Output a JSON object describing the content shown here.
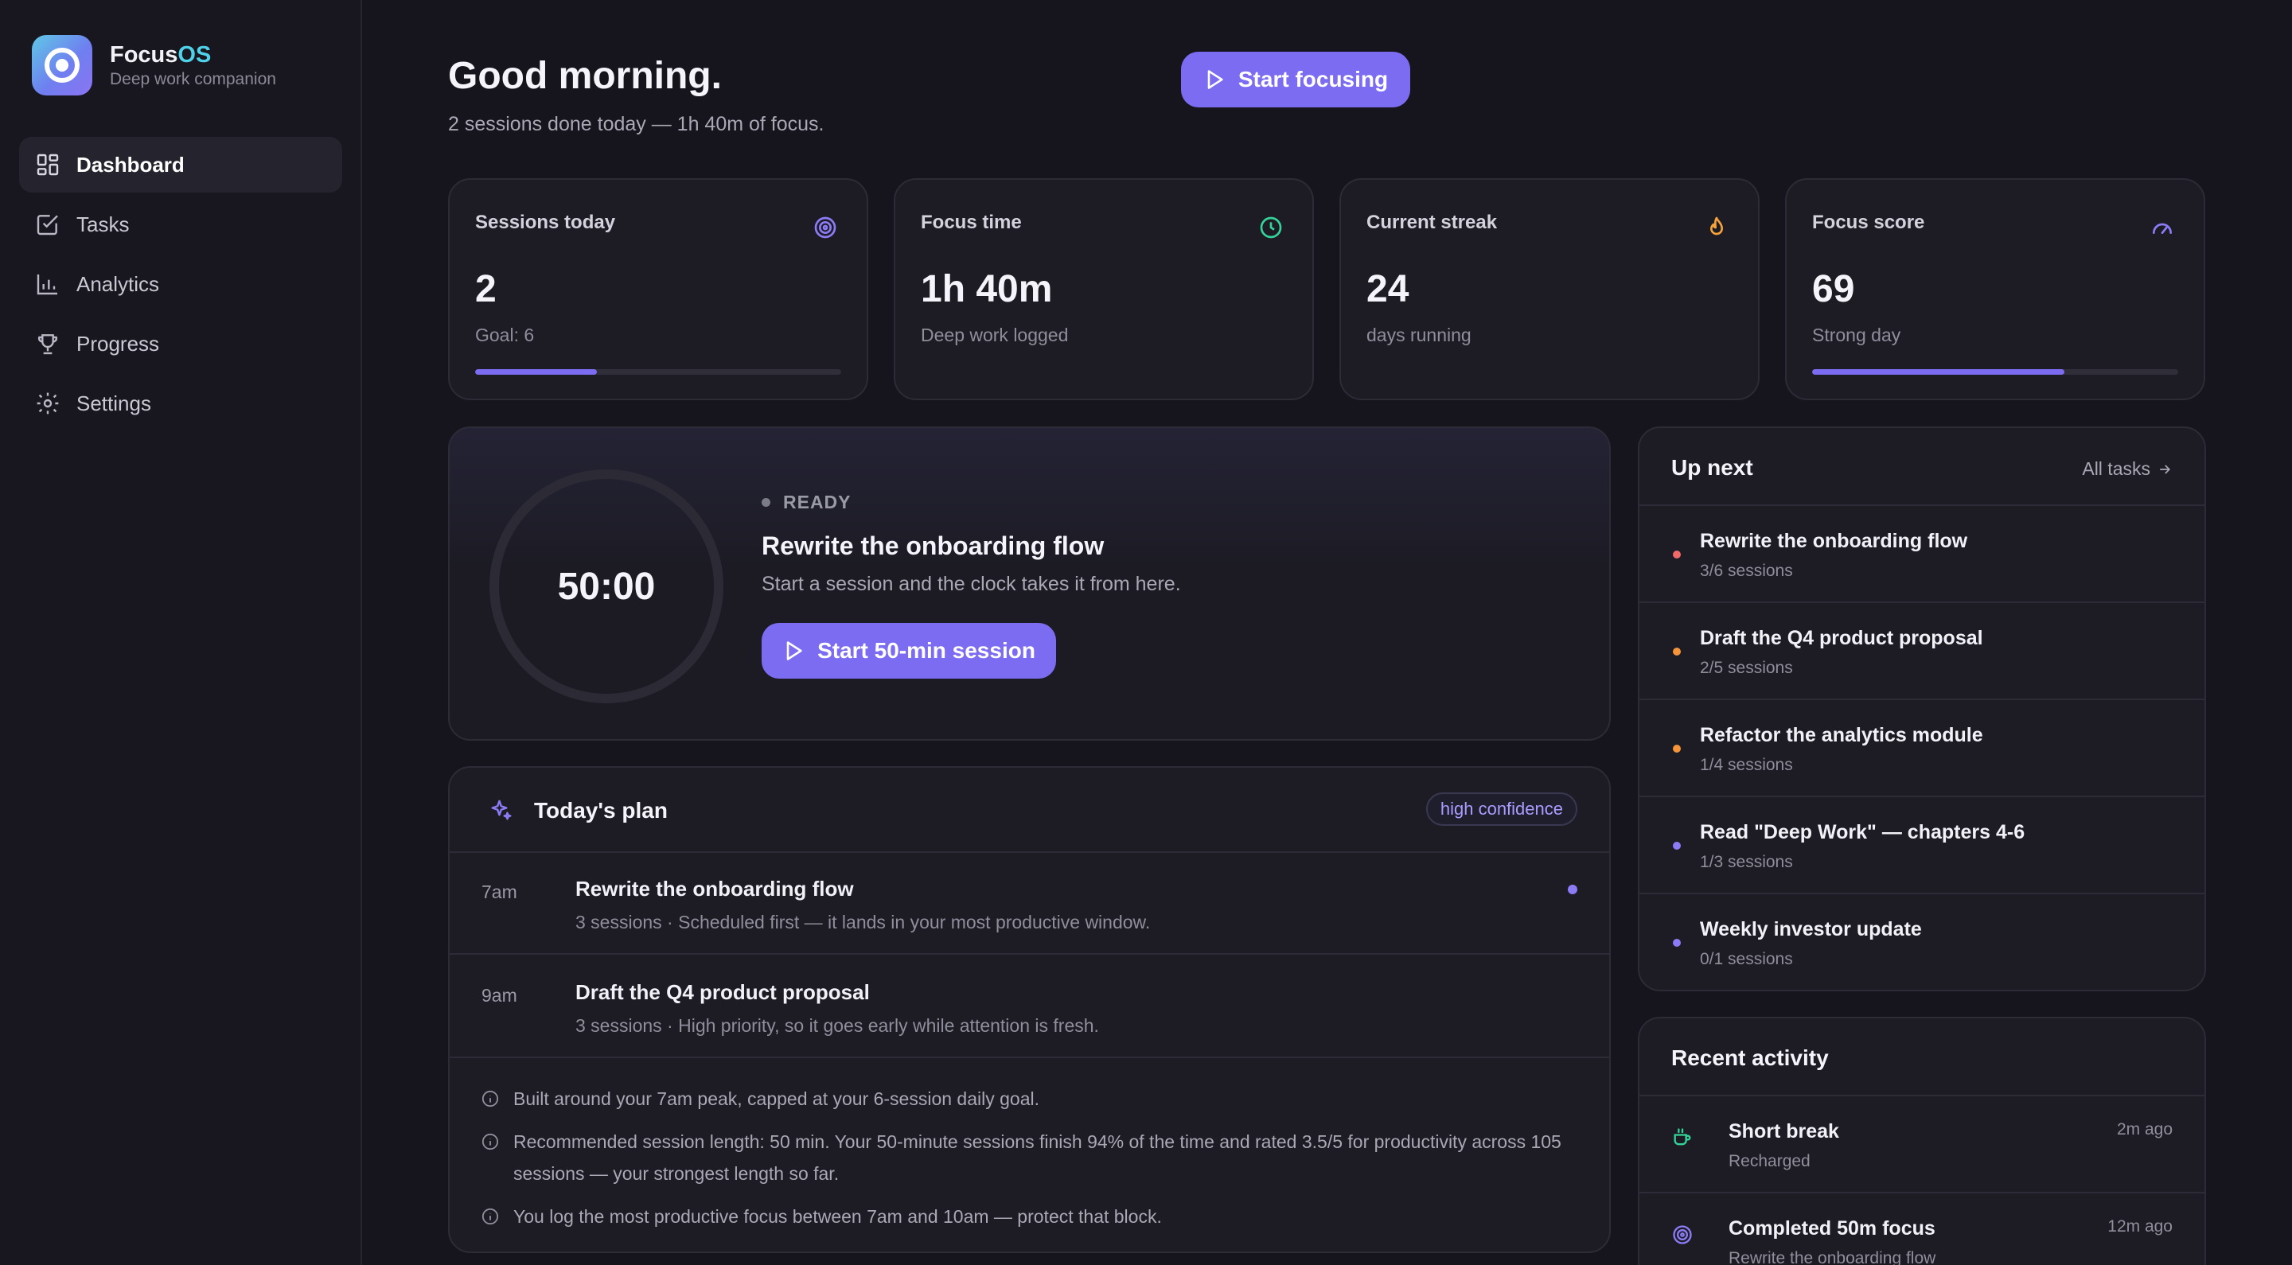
{
  "brand": {
    "name_main": "Focus",
    "name_accent": "OS",
    "subtitle": "Deep work companion"
  },
  "nav": [
    {
      "label": "Dashboard",
      "icon": "dashboard-icon",
      "active": true
    },
    {
      "label": "Tasks",
      "icon": "check-square-icon",
      "active": false
    },
    {
      "label": "Analytics",
      "icon": "bar-chart-icon",
      "active": false
    },
    {
      "label": "Progress",
      "icon": "trophy-icon",
      "active": false
    },
    {
      "label": "Settings",
      "icon": "gear-icon",
      "active": false
    }
  ],
  "header": {
    "greeting": "Good morning.",
    "summary": "2 sessions done today — 1h 40m of focus.",
    "cta_label": "Start focusing"
  },
  "stats": [
    {
      "label": "Sessions today",
      "value": "2",
      "hint": "Goal: 6",
      "icon": "target-icon",
      "progress": 0.333,
      "color": "#8b7cf6"
    },
    {
      "label": "Focus time",
      "value": "1h 40m",
      "hint": "Deep work logged",
      "icon": "clock-icon",
      "color": "#34d399"
    },
    {
      "label": "Current streak",
      "value": "24",
      "hint": "days running",
      "icon": "flame-icon",
      "color": "#f5a23a"
    },
    {
      "label": "Focus score",
      "value": "69",
      "hint": "Strong day",
      "icon": "gauge-icon",
      "progress": 0.69,
      "color": "#8b7cf6"
    }
  ],
  "timer": {
    "time": "50:00",
    "status": "READY",
    "task": "Rewrite the onboarding flow",
    "description": "Start a session and the clock takes it from here.",
    "button_label": "Start 50-min session"
  },
  "plan": {
    "title": "Today's plan",
    "badge": "high confidence",
    "rows": [
      {
        "time": "7am",
        "name": "Rewrite the onboarding flow",
        "meta": "3 sessions · Scheduled first — it lands in your most productive window."
      },
      {
        "time": "9am",
        "name": "Draft the Q4 product proposal",
        "meta": "3 sessions · High priority, so it goes early while attention is fresh."
      }
    ],
    "notes": [
      "Built around your 7am peak, capped at your 6-session daily goal.",
      "Recommended session length: 50 min. Your 50-minute sessions finish 94% of the time and rated 3.5/5 for productivity across 105 sessions — your strongest length so far.",
      "You log the most productive focus between 7am and 10am — protect that block."
    ]
  },
  "upnext": {
    "title": "Up next",
    "link": "All tasks",
    "items": [
      {
        "name": "Rewrite the onboarding flow",
        "meta": "3/6 sessions",
        "color": "#f06a6a"
      },
      {
        "name": "Draft the Q4 product proposal",
        "meta": "2/5 sessions",
        "color": "#f5943a"
      },
      {
        "name": "Refactor the analytics module",
        "meta": "1/4 sessions",
        "color": "#f5943a"
      },
      {
        "name": "Read \"Deep Work\" — chapters 4-6",
        "meta": "1/3 sessions",
        "color": "#8b7cf6"
      },
      {
        "name": "Weekly investor update",
        "meta": "0/1 sessions",
        "color": "#8b7cf6"
      }
    ]
  },
  "activity": {
    "title": "Recent activity",
    "items": [
      {
        "name": "Short break",
        "meta": "Recharged",
        "when": "2m ago",
        "icon": "coffee-icon",
        "color": "#34d399"
      },
      {
        "name": "Completed 50m focus",
        "meta": "Rewrite the onboarding flow",
        "when": "12m ago",
        "icon": "target-icon",
        "color": "#8b7cf6"
      }
    ]
  },
  "colors": {
    "accent": "#7c6cf2",
    "background": "#16151d",
    "card": "#1d1c25"
  }
}
